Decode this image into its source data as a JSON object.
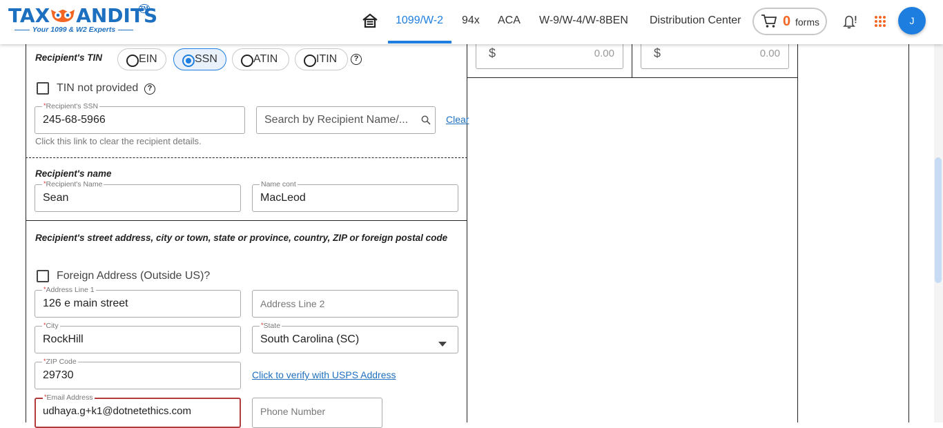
{
  "header": {
    "logo": {
      "part1": "TAX",
      "part2": "ANDITS",
      "tm": "TM",
      "tagline": "Your 1099 & W2 Experts"
    },
    "nav": [
      {
        "label": "1099/W-2",
        "active": true
      },
      {
        "label": "94x"
      },
      {
        "label": "ACA"
      },
      {
        "label": "W-9/W-4/W-8BEN"
      },
      {
        "label": "Distribution Center"
      }
    ],
    "cart": {
      "count": "0",
      "label": "forms"
    },
    "avatar_initial": "J",
    "colors": {
      "brand": "#1d6fc0",
      "accent": "#1d7ee0",
      "cart_count": "#f26522",
      "apps": "#f26522"
    }
  },
  "tin": {
    "title": "Recipient's TIN",
    "options": [
      {
        "label": "EIN",
        "selected": false
      },
      {
        "label": "SSN",
        "selected": true
      },
      {
        "label": "ATIN",
        "selected": false
      },
      {
        "label": "ITIN",
        "selected": false
      }
    ],
    "not_provided_label": "TIN not provided",
    "ssn_label": "Recipient's SSN",
    "ssn_value": "245-68-5966",
    "search_placeholder": "Search by Recipient Name/...",
    "clear_link": "Clear",
    "clear_hint": "Click this link to clear the recipient details."
  },
  "name": {
    "title": "Recipient's name",
    "name_label": "Recipient's Name",
    "name_value": "Sean",
    "cont_label": "Name cont",
    "cont_value": "MacLeod"
  },
  "address": {
    "title": "Recipient's street address, city or town, state or province, country, ZIP or foreign postal code",
    "foreign_label": "Foreign Address (Outside US)?",
    "line1_label": "Address Line 1",
    "line1_value": "126 e main street",
    "line2_placeholder": "Address Line 2",
    "city_label": "City",
    "city_value": "RockHill",
    "state_label": "State",
    "state_value": "South Carolina (SC)",
    "zip_label": "ZIP Code",
    "zip_value": "29730",
    "verify_link": "Click to verify with USPS Address",
    "email_label": "Email Address",
    "email_value": "udhaya.g+k1@dotnetethics.com",
    "phone_placeholder": "Phone Number"
  },
  "amounts": [
    {
      "currency": "$",
      "value": "0.00"
    },
    {
      "currency": "$",
      "value": "0.00"
    }
  ]
}
